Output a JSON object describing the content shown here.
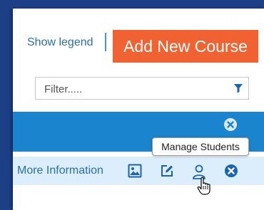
{
  "header": {
    "legend_link": "Show legend",
    "add_button": "Add New Course"
  },
  "filter": {
    "placeholder": "Filter....."
  },
  "row": {
    "more_info": "More Information",
    "icons": [
      "image-icon",
      "edit-icon",
      "user-icon",
      "remove-icon"
    ]
  },
  "tooltip": {
    "text": "Manage Students"
  },
  "colors": {
    "accent_orange": "#f06231",
    "header_blue": "#1a84ce",
    "row_blue": "#dcedfb",
    "link_blue": "#2a6fb0",
    "icon_blue": "#1b64b0",
    "page_bg": "#1d3f85"
  }
}
